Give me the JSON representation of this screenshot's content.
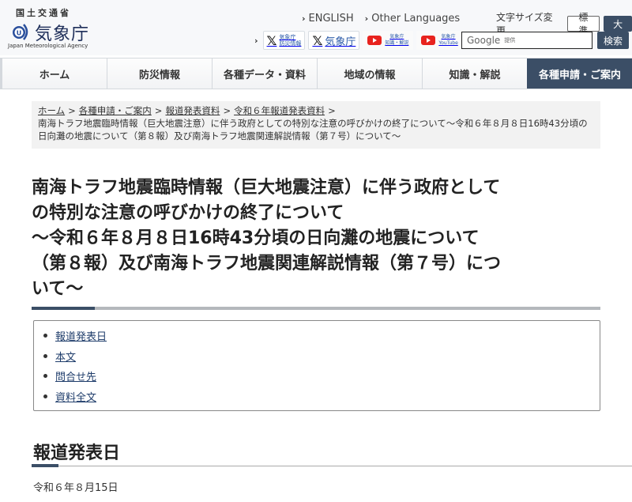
{
  "header": {
    "ministry": "国土交通省",
    "agency": "気象庁",
    "agency_en": "Japan Meteorological Agency",
    "lang_links": [
      "ENGLISH",
      "Other Languages"
    ],
    "sns": [
      {
        "type": "x",
        "line1": "気象庁",
        "line2": "防災情報"
      },
      {
        "type": "x",
        "label": "気象庁"
      },
      {
        "type": "youtube",
        "line1": "気象庁",
        "line2": "知識・解説"
      },
      {
        "type": "youtube",
        "line1": "気象庁",
        "line2": "YouTube"
      }
    ],
    "font_size_label": "文字サイズ変更",
    "font_size_options": [
      "標準",
      "大"
    ],
    "search_placeholder": "Google",
    "search_placeholder_sub": "提供",
    "search_button": "検索"
  },
  "nav": {
    "items": [
      "ホーム",
      "防災情報",
      "各種データ・資料",
      "地域の情報",
      "知識・解説",
      "各種申請・ご案内"
    ],
    "active_index": 5
  },
  "breadcrumb": {
    "links": [
      "ホーム",
      "各種申請・ご案内",
      "報道発表資料",
      "令和６年報道発表資料"
    ],
    "current": "南海トラフ地震臨時情報（巨大地震注意）に伴う政府としての特別な注意の呼びかけの終了について～令和６年８月８日16時43分頃の日向灘の地震について（第８報）及び南海トラフ地震関連解説情報（第７号）について～"
  },
  "title": {
    "line1": "南海トラフ地震臨時情報（巨大地震注意）に伴う政府として",
    "line2": "の特別な注意の呼びかけの終了について",
    "line3": "～令和６年８月８日16時43分頃の日向灘の地震について",
    "line4": "（第８報）及び南海トラフ地震関連解説情報（第７号）につ",
    "line5": "いて～"
  },
  "toc": [
    "報道発表日",
    "本文",
    "問合せ先",
    "資料全文"
  ],
  "section": {
    "heading": "報道発表日",
    "date": "令和６年８月15日"
  },
  "colors": {
    "primary": "#3b4e66",
    "link": "#1f3d6b",
    "youtube": "#e8231e"
  }
}
